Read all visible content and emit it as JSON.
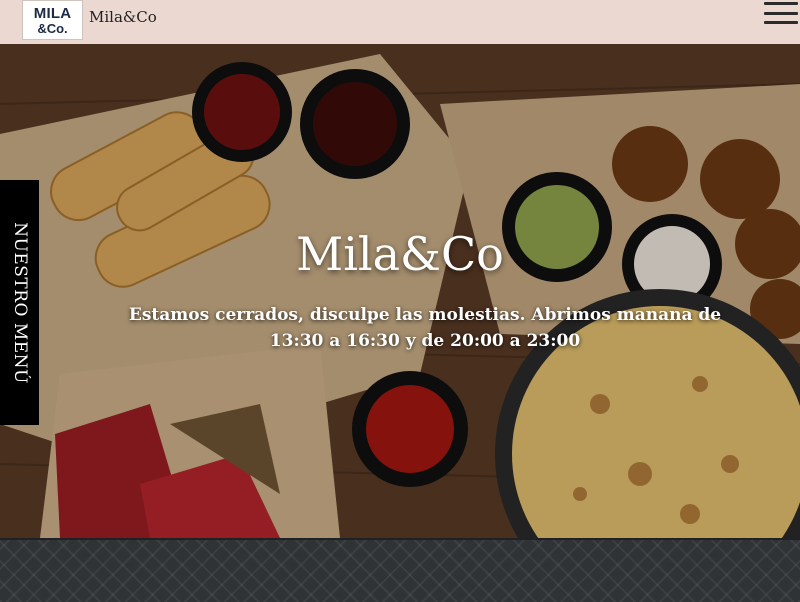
{
  "header": {
    "logo_line1": "MILA",
    "logo_line2": "&Co.",
    "brand": "Mila&Co"
  },
  "hero": {
    "title": "Mila&Co",
    "subtitle": "Estamos cerrados, disculpe las molestias. Abrimos manana de 13:30 a 16:30 y de 20:00 a 23:00"
  },
  "side_tab": {
    "label": "NUESTRO MENÚ"
  },
  "colors": {
    "header_bg": "#ead8d1",
    "footer_bg": "#2f3336",
    "tab_bg": "#000000"
  },
  "icons": {
    "menu": "hamburger-icon"
  }
}
